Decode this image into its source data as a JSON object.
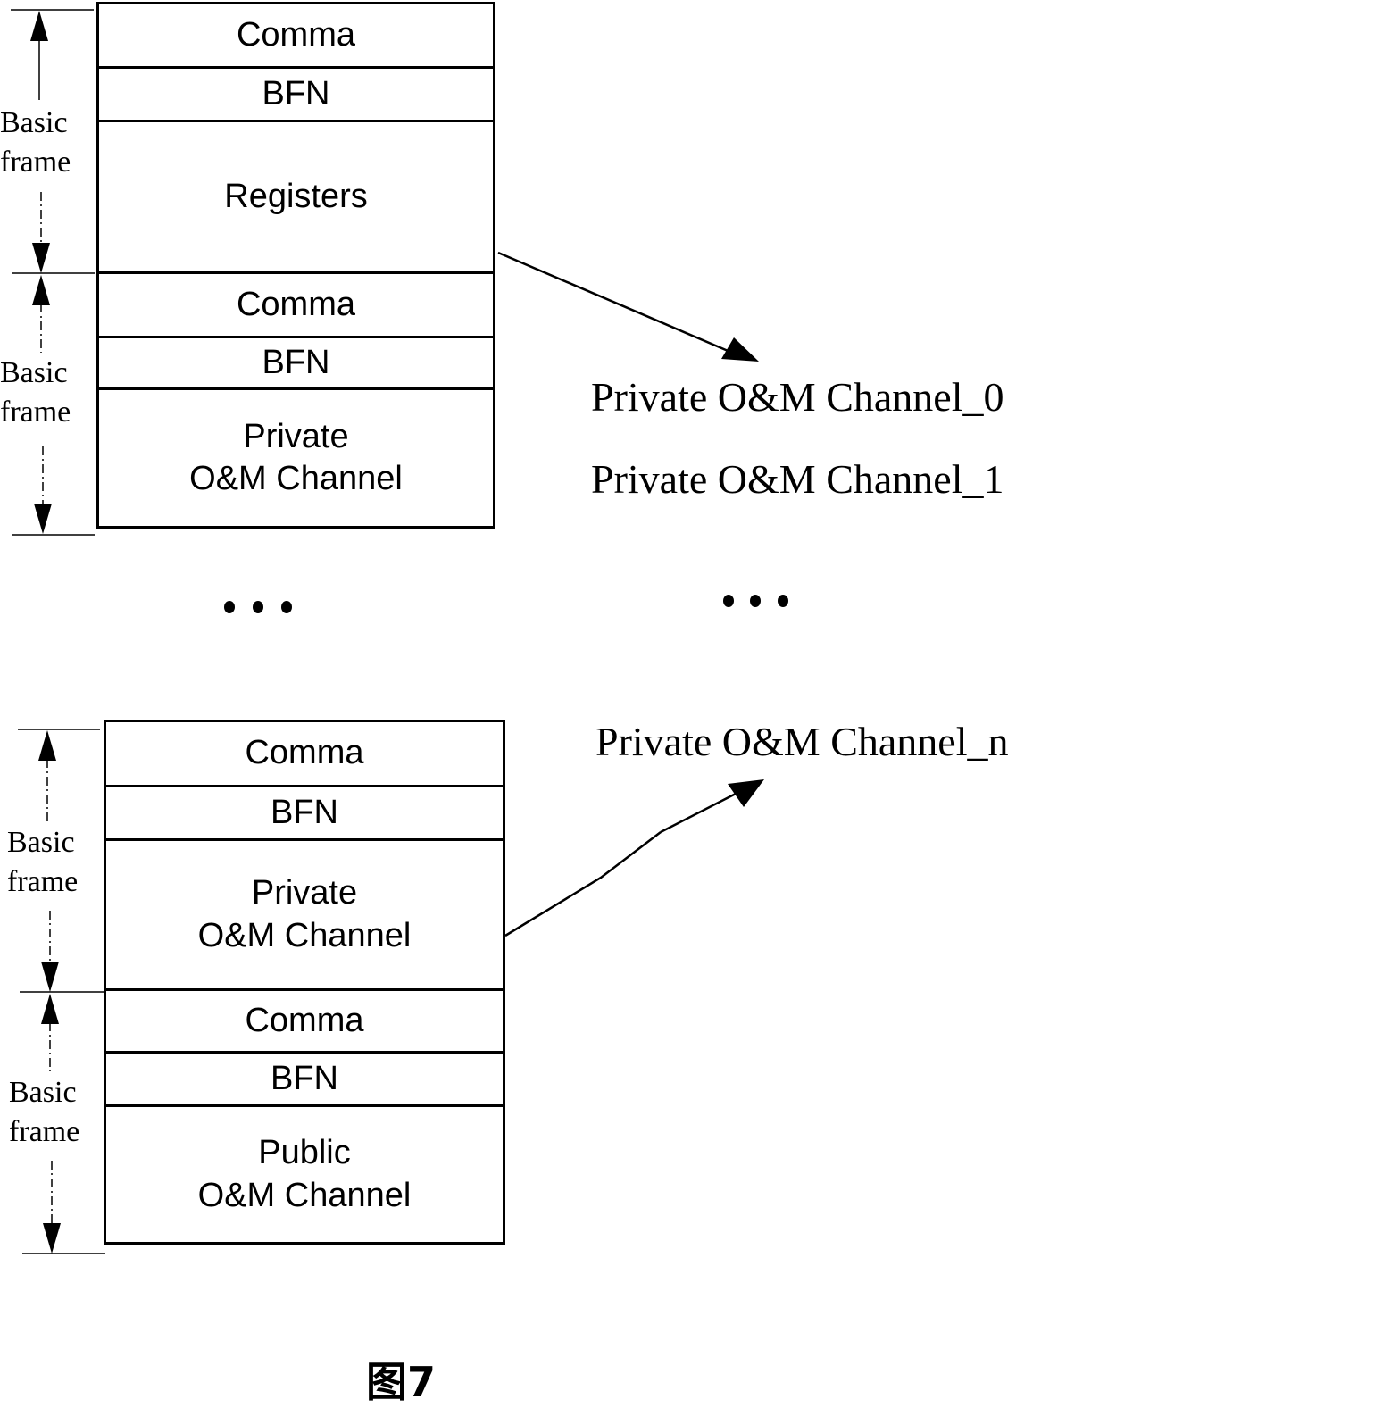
{
  "diagram": {
    "caption": "图7",
    "side_label": "Basic\nframe",
    "top_stack": {
      "frames": [
        {
          "label": "Basic\nframe",
          "cells": [
            {
              "lines": [
                "Comma"
              ]
            },
            {
              "lines": [
                "BFN"
              ]
            },
            {
              "lines": [
                "Registers"
              ]
            }
          ]
        },
        {
          "label": "Basic\nframe",
          "cells": [
            {
              "lines": [
                "Comma"
              ]
            },
            {
              "lines": [
                "BFN"
              ]
            },
            {
              "lines": [
                "Private",
                "O&M Channel"
              ]
            }
          ]
        }
      ]
    },
    "bottom_stack": {
      "frames": [
        {
          "label": "Basic\nframe",
          "cells": [
            {
              "lines": [
                "Comma"
              ]
            },
            {
              "lines": [
                "BFN"
              ]
            },
            {
              "lines": [
                "Private",
                "O&M Channel"
              ]
            }
          ]
        },
        {
          "label": "Basic\nframe",
          "cells": [
            {
              "lines": [
                "Comma"
              ]
            },
            {
              "lines": [
                "BFN"
              ]
            },
            {
              "lines": [
                "Public",
                "O&M Channel"
              ]
            }
          ]
        }
      ]
    },
    "channels": {
      "channel_0": "Private O&M Channel_0",
      "channel_1": "Private O&M Channel_1",
      "channel_n": "Private O&M Channel_n"
    },
    "ellipsis": "• • •"
  }
}
